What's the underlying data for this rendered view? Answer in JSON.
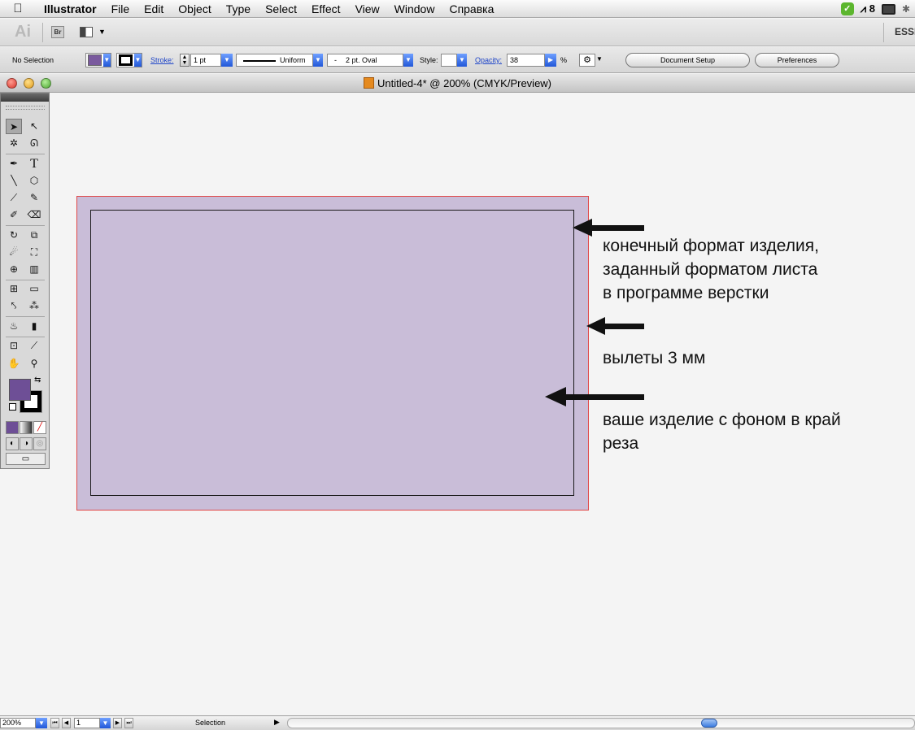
{
  "menubar": {
    "app_name": "Illustrator",
    "items": [
      "File",
      "Edit",
      "Object",
      "Type",
      "Select",
      "Effect",
      "View",
      "Window",
      "Справка"
    ],
    "status": {
      "adobe_updates": "8"
    }
  },
  "appbar": {
    "logo": "Ai",
    "bridge_label": "Br",
    "workspace": "ESSE"
  },
  "controlbar": {
    "selection_status": "No Selection",
    "fill_color": "#7a5a9e",
    "stroke_label": "Stroke:",
    "stroke_weight": "1 pt",
    "stroke_profile": "Uniform",
    "brush_dash": "-",
    "brush": "2 pt. Oval",
    "style_label": "Style:",
    "opacity_label": "Opacity:",
    "opacity_value": "38",
    "opacity_unit": "%",
    "document_setup": "Document Setup",
    "preferences": "Preferences"
  },
  "window": {
    "title": "Untitled-4* @ 200% (CMYK/Preview)"
  },
  "tools": {
    "fill_color": "#6e4f96",
    "stroke_color": "#000000"
  },
  "artboard": {
    "bleed_fill": "#c9bdd8",
    "bleed_line_color": "#e04848",
    "trim_line_color": "#1a1a1a"
  },
  "annotations": {
    "trim_note_line1": "конечный формат изделия,",
    "trim_note_line2": "заданный форматом листа",
    "trim_note_line3": "в программе верстки",
    "bleed_note": "вылеты 3 мм",
    "background_note_line1": "ваше изделие с фоном в край",
    "background_note_line2": "реза"
  },
  "statusbar": {
    "zoom": "200%",
    "artboard_number": "1",
    "current_tool": "Selection"
  }
}
